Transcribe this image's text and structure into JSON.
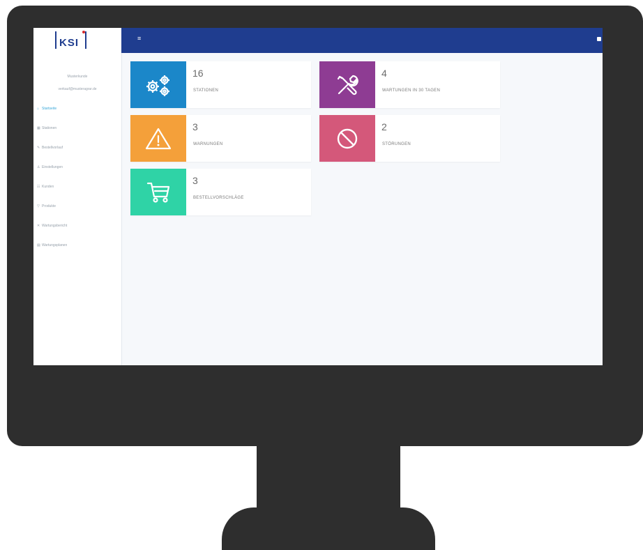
{
  "header": {
    "logo_text": "KSI"
  },
  "sidebar": {
    "user_name": "Musterkunde",
    "user_email": "verkauf@musteragrar.de",
    "items": [
      {
        "label": "Startseite",
        "icon": "home-icon",
        "active": true
      },
      {
        "label": "Stationen",
        "icon": "stations-icon",
        "active": false
      },
      {
        "label": "Bestellvorlauf",
        "icon": "edit-icon",
        "active": false
      },
      {
        "label": "Einstellungen",
        "icon": "user-icon",
        "active": false
      },
      {
        "label": "Kunden",
        "icon": "customers-icon",
        "active": false
      },
      {
        "label": "Produkte",
        "icon": "filter-icon",
        "active": false
      },
      {
        "label": "Wartungsbericht",
        "icon": "wrench-icon",
        "active": false
      },
      {
        "label": "Wartungsplanen",
        "icon": "calendar-icon",
        "active": false
      }
    ]
  },
  "tiles": [
    {
      "count": "16",
      "label": "STATIONEN",
      "color": "#1b87c9",
      "icon": "gears-icon"
    },
    {
      "count": "4",
      "label": "WARTUNGEN IN 30 TAGEN",
      "color": "#8e3c93",
      "icon": "tools-icon"
    },
    {
      "count": "3",
      "label": "WARNUNGEN",
      "color": "#f4a03a",
      "icon": "warning-icon"
    },
    {
      "count": "2",
      "label": "STÖRUNGEN",
      "color": "#d4587a",
      "icon": "blocked-icon"
    },
    {
      "count": "3",
      "label": "BESTELLVORSCHLÄGE",
      "color": "#2fd3a6",
      "icon": "cart-icon"
    }
  ],
  "colors": {
    "topbar": "#1f3d8f",
    "monitor": "#2e2e2e",
    "active_nav": "#3aa8d9"
  }
}
